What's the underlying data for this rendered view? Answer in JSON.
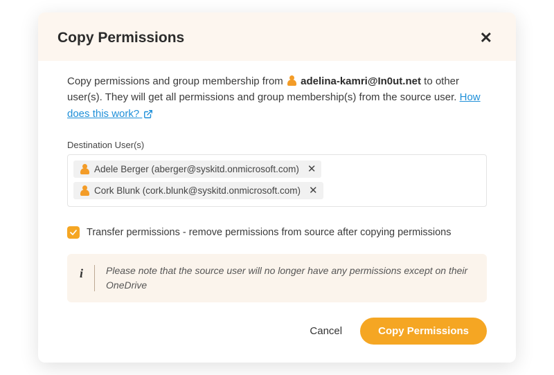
{
  "modal": {
    "title": "Copy Permissions",
    "intro_part1": "Copy permissions and group membership from ",
    "source_user_email": "adelina-kamri@In0ut.net",
    "intro_part2": " to other user(s). They will get all permissions and group membership(s) from the source user. ",
    "help_link_text": "How does this work?"
  },
  "destination": {
    "label": "Destination User(s)",
    "users": [
      {
        "display": "Adele Berger (aberger@syskitd.onmicrosoft.com)"
      },
      {
        "display": "Cork Blunk (cork.blunk@syskitd.onmicrosoft.com)"
      }
    ]
  },
  "transfer_checkbox": {
    "checked": true,
    "label": "Transfer permissions - remove permissions from source after copying permissions"
  },
  "note": {
    "text": "Please note that the source user will no longer have any permissions except on their OneDrive"
  },
  "footer": {
    "cancel": "Cancel",
    "confirm": "Copy Permissions"
  }
}
